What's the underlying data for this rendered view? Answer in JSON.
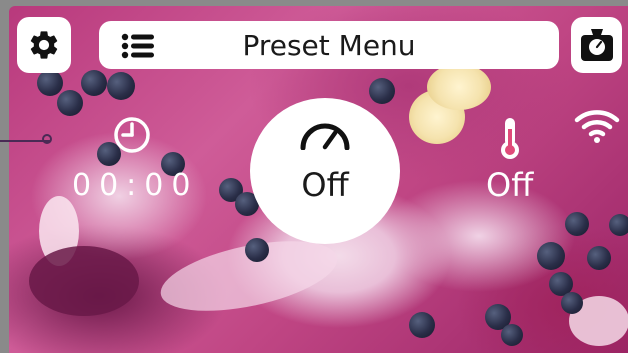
{
  "header": {
    "title": "Preset Menu",
    "left_button_icon": "gear-icon",
    "menu_icon": "list-icon",
    "right_button_icon": "scale-icon"
  },
  "status": {
    "timer": "00:00",
    "timer_icon": "clock-icon",
    "speed": "Off",
    "speed_icon": "speedometer-icon",
    "temperature": "Off",
    "temperature_icon": "thermometer-icon",
    "connectivity_icon": "wifi-icon"
  },
  "colors": {
    "panel": "#ffffff",
    "text_dark": "#1a1a1a",
    "text_light": "#ffffff",
    "background_accent": "#c04684"
  }
}
